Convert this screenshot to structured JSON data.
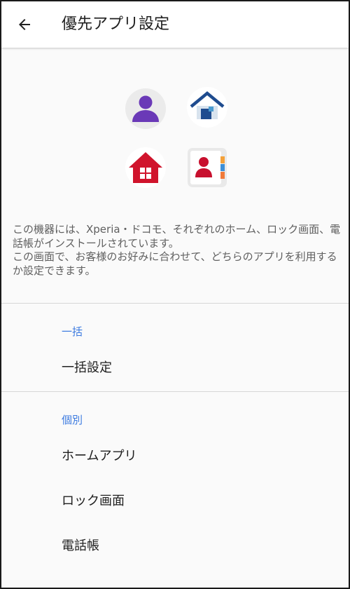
{
  "appbar": {
    "back_icon": "arrow-left-icon",
    "title": "優先アプリ設定"
  },
  "icons": {
    "items": [
      {
        "name": "docomo-contact-person-icon",
        "color": "#6a39b7"
      },
      {
        "name": "xperia-home-icon",
        "color": "#1f4c8f"
      },
      {
        "name": "docomo-home-icon",
        "color": "#d0142c"
      },
      {
        "name": "phonebook-contact-icon",
        "color": "#c8102e"
      }
    ]
  },
  "description": {
    "line1": "この機器には、Xperia・ドコモ、それぞれのホーム、ロック画面、電話帳がインストールされています。",
    "line2": "この画面で、お客様のお好みに合わせて、どちらのアプリを利用するか設定できます。"
  },
  "sections": {
    "bulk": {
      "header": "一括",
      "items": [
        {
          "label": "一括設定"
        }
      ]
    },
    "individual": {
      "header": "個別",
      "items": [
        {
          "label": "ホームアプリ"
        },
        {
          "label": "ロック画面"
        },
        {
          "label": "電話帳"
        }
      ]
    }
  },
  "colors": {
    "accent": "#3d7be0",
    "divider": "#d6d6d6",
    "background": "#fafafa"
  }
}
